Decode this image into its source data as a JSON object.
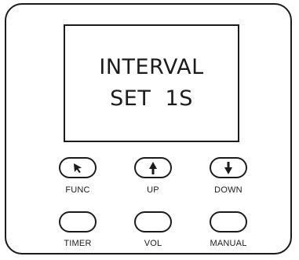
{
  "display": {
    "line1": "INTERVAL",
    "line2": "SET  1S"
  },
  "buttons": {
    "func": {
      "label": "FUNC",
      "icon": "cursor-arrow-icon"
    },
    "up": {
      "label": "UP",
      "icon": "arrow-up-icon"
    },
    "down": {
      "label": "DOWN",
      "icon": "arrow-down-icon"
    },
    "timer": {
      "label": "TIMER"
    },
    "vol": {
      "label": "VOL"
    },
    "manual": {
      "label": "MANUAL"
    }
  }
}
